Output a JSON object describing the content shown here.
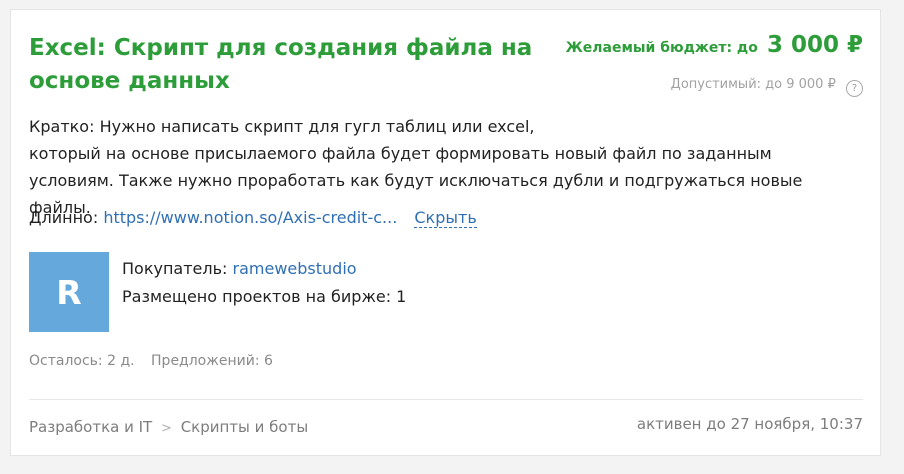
{
  "project": {
    "title": "Excel: Скрипт для создания файла на основе данных",
    "budget_label": "Желаемый бюджет: до",
    "budget_value": "3 000 ₽",
    "allowed_text": "Допустимый: до 9 000 ₽",
    "help_symbol": "?",
    "brief_label": "Кратко:",
    "brief_line1": "Нужно написать скрипт для гугл таблиц или excel,",
    "brief_line2": "который на основе присылаемого файла будет формировать новый файл по заданным",
    "brief_line3": "условиям. Также нужно проработать как будут исключаться дубли и подгружаться новые файлы.",
    "long_label": "Длинно:",
    "long_link": "https://www.notion.so/Axis-credit-c...",
    "hide_label": "Скрыть"
  },
  "buyer": {
    "avatar_letter": "R",
    "label": "Покупатель:",
    "name": "ramewebstudio",
    "projects_text": "Размещено проектов на бирже: 1"
  },
  "stats": {
    "remaining": "Осталось: 2 д.",
    "offers": "Предложений: 6"
  },
  "footer": {
    "crumbs": [
      "Разработка и IT",
      "Скрипты и боты"
    ],
    "crumb_sep": ">",
    "active_until": "активен до 27 ноября, 10:37"
  },
  "colors": {
    "accent_green": "#2d9d3a",
    "link_blue": "#2f6fb5",
    "avatar_blue": "#65a9dc"
  }
}
